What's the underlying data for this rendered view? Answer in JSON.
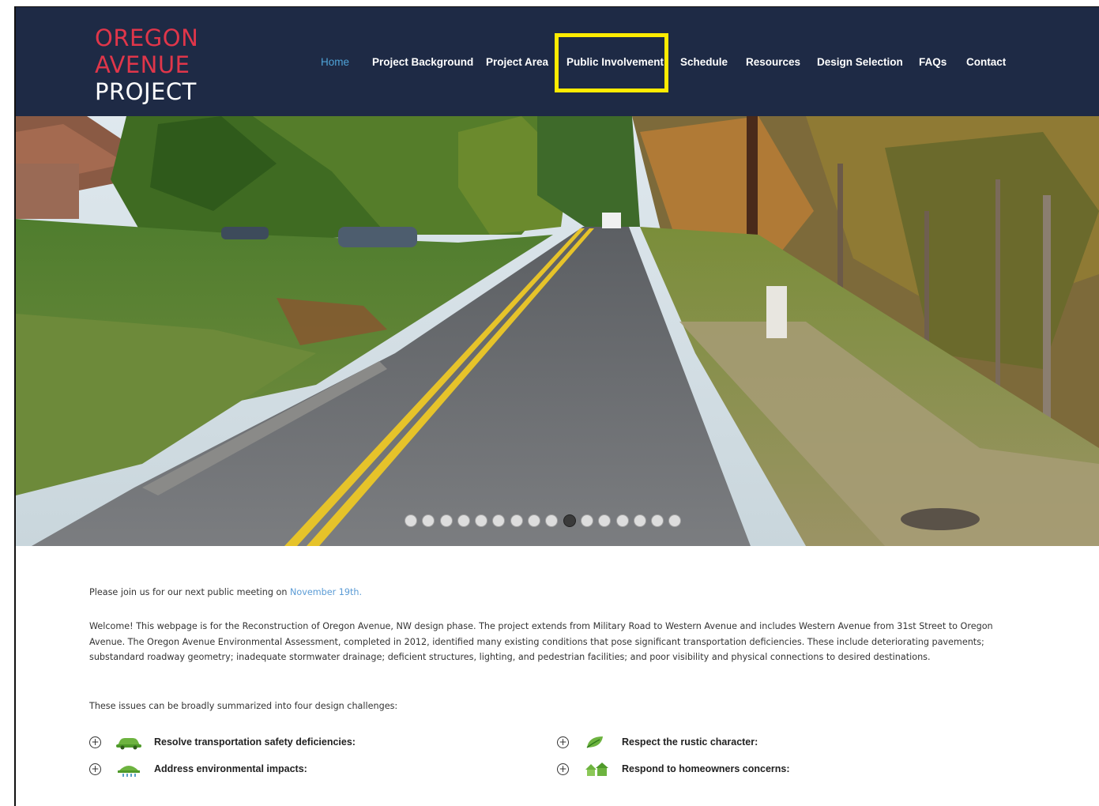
{
  "logo": {
    "line1": "OREGON",
    "line2": "AVENUE",
    "line3": "PROJECT"
  },
  "nav": {
    "items": [
      {
        "label": "Home",
        "active": true
      },
      {
        "label": "Project Background"
      },
      {
        "label": "Project Area"
      },
      {
        "label": "Public Involvement",
        "highlighted": true
      },
      {
        "label": "Schedule"
      },
      {
        "label": "Resources"
      },
      {
        "label": "Design Selection"
      },
      {
        "label": "FAQs"
      },
      {
        "label": "Contact"
      }
    ]
  },
  "slider": {
    "dot_count": 16,
    "active_dot": 10
  },
  "content": {
    "meeting_prefix": "Please join us for our next public meeting on ",
    "meeting_link": "November 19th.",
    "welcome": "Welcome! This webpage is for the Reconstruction of Oregon Avenue, NW design phase. The project extends from Military Road to Western Avenue and includes Western Avenue from 31st Street to Oregon Avenue. The Oregon Avenue Environmental Assessment, completed in 2012, identified many existing conditions that pose significant transportation deficiencies. These include deteriorating pavements; substandard roadway geometry; inadequate stormwater drainage; deficient structures, lighting, and pedestrian facilities; and poor visibility and physical connections to desired destinations.",
    "summary": "These issues can be broadly summarized into four design challenges:"
  },
  "challenges": [
    {
      "label": "Resolve transportation safety deficiencies:",
      "icon": "car-icon"
    },
    {
      "label": "Address environmental impacts:",
      "icon": "drainage-icon"
    },
    {
      "label": "Respect the rustic character:",
      "icon": "leaf-icon"
    },
    {
      "label": "Respond to homeowners concerns:",
      "icon": "houses-icon"
    }
  ],
  "colors": {
    "header_bg": "#1e2a45",
    "logo_red": "#e0364a",
    "nav_active": "#4fa3d8",
    "highlight": "#ffeb00",
    "link": "#5a9bd5",
    "icon_green": "#6db33f"
  }
}
